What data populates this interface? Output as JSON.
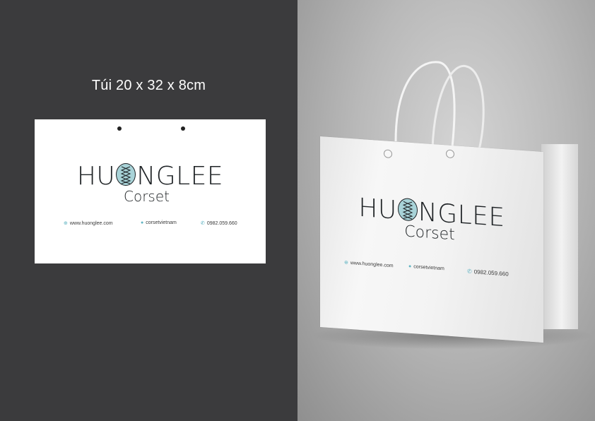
{
  "left": {
    "title": "Túi 20 x 32 x 8cm",
    "card": {
      "logo_word_before": "HU",
      "logo_word_after": "NGLEE",
      "logo_sub": "Corset",
      "contacts": [
        {
          "icon": "globe-icon",
          "text": "www.huonglee.com"
        },
        {
          "icon": "facebook-icon",
          "text": "corsetvietnam"
        },
        {
          "icon": "phone-icon",
          "text": "0982.059.660"
        }
      ]
    }
  },
  "bag": {
    "logo_word_before": "HU",
    "logo_word_after": "NGLEE",
    "logo_sub": "Corset",
    "contacts": [
      {
        "icon": "globe-icon",
        "text": "www.huonglee.com"
      },
      {
        "icon": "facebook-icon",
        "text": "corsetvietnam"
      },
      {
        "icon": "phone-icon",
        "text": "0982.059.660"
      }
    ]
  },
  "colors": {
    "left_background": "#3b3b3d",
    "logo_accent": "#a8d3d8",
    "icon_accent": "#5fb3c2"
  }
}
